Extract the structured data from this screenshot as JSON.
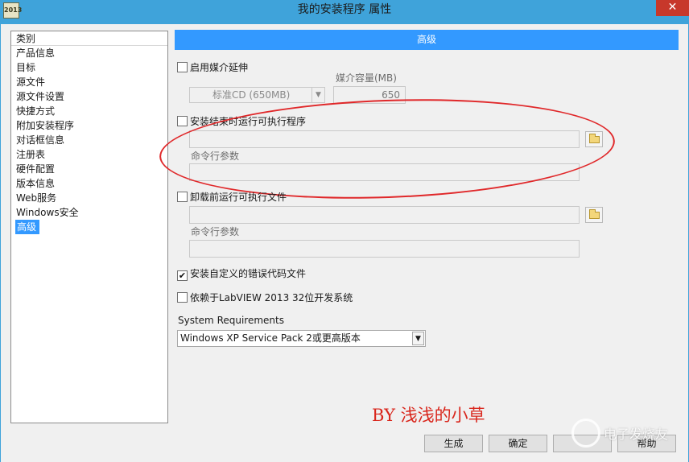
{
  "window": {
    "title": "我的安装程序 属性",
    "app_icon_text": "2013",
    "close_glyph": "✕"
  },
  "sidebar": {
    "header": "类别",
    "items": [
      "产品信息",
      "目标",
      "源文件",
      "源文件设置",
      "快捷方式",
      "附加安装程序",
      "对话框信息",
      "注册表",
      "硬件配置",
      "版本信息",
      "Web服务",
      "Windows安全",
      "高级"
    ],
    "selected": "高级"
  },
  "main": {
    "section_title": "高级",
    "media_spanning": {
      "checkbox_label": "启用媒介延伸",
      "checked": false,
      "capacity_label": "媒介容量(MB)",
      "media_select_value": "标准CD (650MB)",
      "capacity_value": "650"
    },
    "run_after_install": {
      "checkbox_label": "安装结束时运行可执行程序",
      "checked": false,
      "path_value": "",
      "args_label": "命令行参数",
      "args_value": ""
    },
    "run_before_uninstall": {
      "checkbox_label": "卸载前运行可执行文件",
      "checked": false,
      "path_value": "",
      "args_label": "命令行参数",
      "args_value": ""
    },
    "custom_error_files": {
      "checkbox_label": "安装自定义的错误代码文件",
      "checked": true,
      "check_glyph": "✔"
    },
    "depends_labview": {
      "checkbox_label": "依赖于LabVIEW 2013 32位开发系统",
      "checked": false
    },
    "system_requirements": {
      "label": "System Requirements",
      "selected_value": "Windows XP Service Pack 2或更高版本"
    }
  },
  "buttons": {
    "build": "生成",
    "ok": "确定",
    "cancel": "",
    "help": "帮助"
  },
  "watermark": {
    "author": "BY 浅浅的小草",
    "site": "电子发烧友"
  },
  "icons": {
    "dropdown": "▼"
  }
}
